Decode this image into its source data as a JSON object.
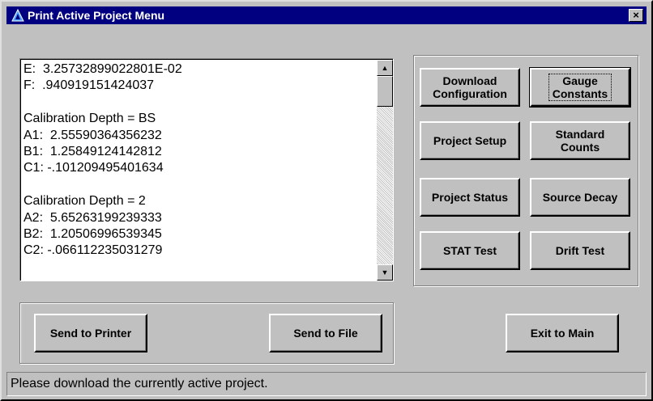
{
  "window": {
    "title": "Print Active Project Menu",
    "close_label": "×"
  },
  "listbox": {
    "lines": [
      "E:  3.25732899022801E-02",
      "F:  .940919151424037",
      "",
      "Calibration Depth = BS",
      "A1:  2.55590364356232",
      "B1:  1.25849124142812",
      "C1: -.101209495401634",
      "",
      "Calibration Depth = 2",
      "A2:  5.65263199239333",
      "B2:  1.20506996539345",
      "C2: -.066112235031279"
    ],
    "scroll_up_icon": "▲",
    "scroll_down_icon": "▼"
  },
  "actions": {
    "download_configuration": "Download\nConfiguration",
    "gauge_constants": "Gauge\nConstants",
    "project_setup": "Project Setup",
    "standard_counts": "Standard\nCounts",
    "project_status": "Project Status",
    "source_decay": "Source Decay",
    "stat_test": "STAT Test",
    "drift_test": "Drift Test"
  },
  "output": {
    "send_to_printer": "Send to Printer",
    "send_to_file": "Send to File"
  },
  "exit": {
    "label": "Exit to Main"
  },
  "status": {
    "text": "Please download the currently active project."
  },
  "colors": {
    "titlebar": "#000080",
    "face": "#c0c0c0",
    "title_text": "#ffffff"
  }
}
